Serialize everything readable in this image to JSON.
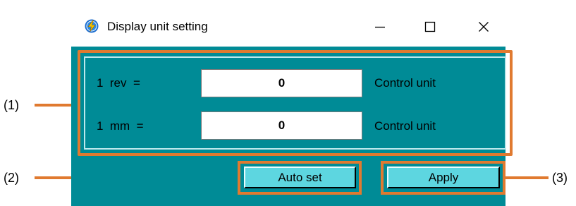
{
  "window": {
    "title": "Display unit setting",
    "app_icon": "lightning-bolt-icon",
    "controls": {
      "minimize_icon": "minimize-icon",
      "maximize_icon": "maximize-icon",
      "close_icon": "close-icon"
    }
  },
  "settings": {
    "rows": [
      {
        "label": "1  rev  =",
        "value": "0",
        "unit": "Control unit"
      },
      {
        "label": "1  mm  =",
        "value": "0",
        "unit": "Control unit"
      }
    ]
  },
  "buttons": {
    "auto_set_label": "Auto set",
    "apply_label": "Apply"
  },
  "callouts": {
    "panel": "(1)",
    "auto_set": "(2)",
    "apply": "(3)"
  },
  "colors": {
    "window_background": "#008b96",
    "highlight": "#e07a30",
    "button_face": "#5dd6e0",
    "panel_border": "#bde8ec"
  }
}
